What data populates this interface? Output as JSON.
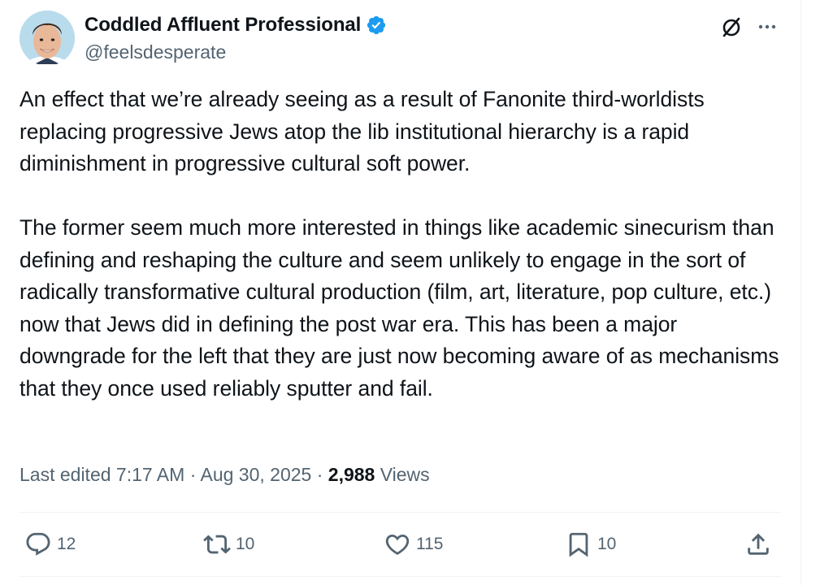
{
  "author": {
    "name": "Coddled Affluent Professional",
    "handle": "@feelsdesperate",
    "verified": true
  },
  "icons": {
    "verified": "verified-badge-icon",
    "grok": "grok-icon",
    "more": "more-options-icon"
  },
  "colors": {
    "verified_blue": "#1d9bf0",
    "text_primary": "#0f1419",
    "text_secondary": "#536471",
    "divider": "#eff3f4"
  },
  "tweet": {
    "paragraphs": [
      "An effect that we’re already seeing as a result of Fanonite third-worldists replacing progressive Jews atop the lib institutional hierarchy is a rapid diminishment in progressive cultural soft power.",
      "The former seem much more interested in things like academic sinecurism than defining and reshaping the culture and seem unlikely to engage in the sort of radically transformative cultural production (film, art, literature, pop culture, etc.) now that Jews did in defining the post war era. This has been a major downgrade for the left that they are just now becoming aware of as mechanisms that they once used reliably sputter and fail."
    ]
  },
  "meta": {
    "edited_label": "Last edited 7:17 AM",
    "separator": " · ",
    "date": "Aug 30, 2025",
    "views_count": "2,988",
    "views_label": "Views"
  },
  "actions": {
    "replies": "12",
    "reposts": "10",
    "likes": "115",
    "bookmarks": "10"
  }
}
